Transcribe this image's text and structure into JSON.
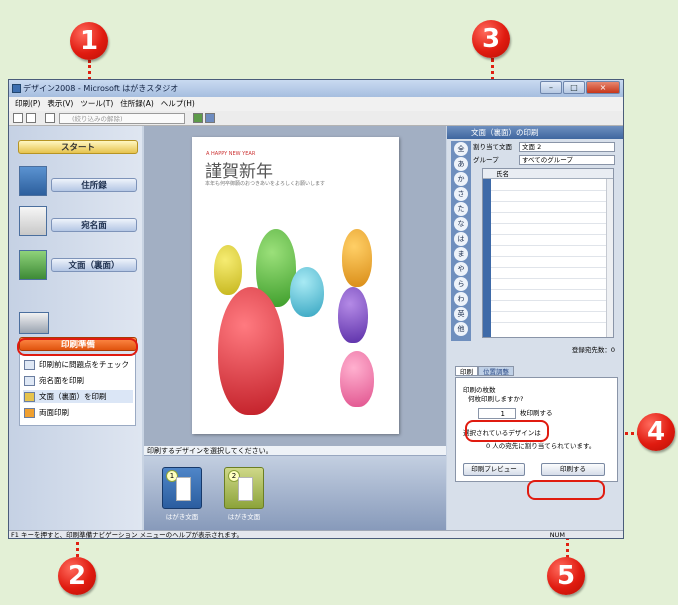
{
  "window": {
    "title": "デザイン2008 - Microsoft はがきスタジオ",
    "controls": [
      "–",
      "□",
      "×"
    ]
  },
  "menu": [
    "印刷(P)",
    "表示(V)",
    "ツール(T)",
    "住所録(A)",
    "ヘルプ(H)"
  ],
  "toolbar": {
    "filter_placeholder": "(絞り込みの解除)"
  },
  "sidebar": {
    "start": "スタート",
    "address_book": "住所録",
    "address_side": "宛名面",
    "design_side": "文面（裏面）",
    "print_prep": "印刷準備",
    "subitems": [
      "印刷前に問題点をチェック",
      "宛名面を印刷",
      "文面（裏面）を印刷",
      "両面印刷"
    ]
  },
  "card": {
    "english": "A HAPPY NEW YEAR",
    "greeting": "謹賀新年",
    "message": "本年も何卒御願のおつきあいをよろしくお願いします"
  },
  "bottom": {
    "prompt": "印刷するデザインを選択してください。",
    "thumbs": [
      {
        "number": "1",
        "label": "はがき文面"
      },
      {
        "number": "2",
        "label": "はがき文面"
      }
    ]
  },
  "right": {
    "title": "文面（裏面）の印刷",
    "assign_label": "割り当て文面",
    "assign_value": "文面 2",
    "group_label": "グループ",
    "group_value": "すべてのグループ",
    "col_name": "氏名",
    "kana_tabs": [
      "全",
      "あ",
      "か",
      "さ",
      "た",
      "な",
      "は",
      "ま",
      "や",
      "ら",
      "わ",
      "英",
      "他"
    ],
    "registered": "登録宛先数：0",
    "tab_print": "印刷",
    "tab_position": "位置調整",
    "copies_header": "印刷の枚数",
    "copies_question": "何枚印刷しますか?",
    "copies_value": "1",
    "copies_suffix": "枚印刷する",
    "selected_header": "選択されているデザインは",
    "selected_info": "0 人の宛先に割り当てられています。",
    "preview_btn": "印刷プレビュー",
    "print_btn": "印刷する"
  },
  "statusbar": {
    "text": "F1 キーを押すと、印刷準備ナビゲーション メニューのヘルプが表示されます。",
    "num": "NUM"
  },
  "callouts": [
    "1",
    "2",
    "3",
    "4",
    "5"
  ],
  "colors": {
    "accent": "#e01b10",
    "background": "#e3f0d6",
    "title_blue": "#3f669f"
  }
}
